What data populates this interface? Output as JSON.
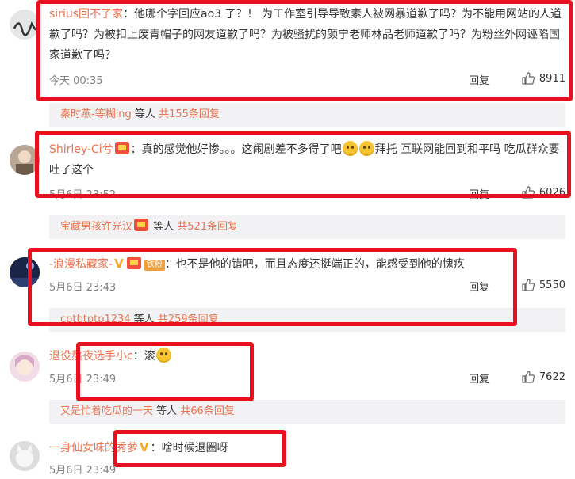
{
  "comments": [
    {
      "username": "sirius回不了家",
      "text": "：他哪个字回应ao3 了？！ 为工作室引导导致素人被网暴道歉了吗？为不能用网站的人道歉了吗？为被扣上废青帽子的网友道歉了吗？为被骚扰的颜宁老师林品老师道歉了吗？为粉丝外网诬陷国家道歉了吗？",
      "time": "今天 00:35",
      "reply": "回复",
      "likes": "8911"
    },
    {
      "username": "Shirley-Ci兮",
      "text_a": "：真的感觉他好惨。。。这闹剧差不多得了吧",
      "text_b": "拜托 互联网能回到和平吗 吃瓜群众要吐了这个",
      "time": "5月6日 23:52",
      "reply": "回复",
      "likes": "6026"
    },
    {
      "username": "-浪漫私藏家-",
      "fan_badge": "铁粉",
      "text": "：也不是他的错吧，而且态度还挺端正的，能感受到他的愧疚",
      "time": "5月6日 23:43",
      "reply": "回复",
      "likes": "5550"
    },
    {
      "username": "退役熬夜选手小c",
      "text": "：滚",
      "time": "5月6日 23:49",
      "reply": "回复",
      "likes": "7622"
    },
    {
      "username": "一身仙女味的秀萝",
      "text": "：啥时候退圈呀",
      "time": "5月6日 23:49",
      "reply": "回复"
    }
  ],
  "subreplies": [
    {
      "username": "秦时燕-等糊ing",
      "mid": " 等人 ",
      "count": "共155条回复"
    },
    {
      "username": "宝藏男孩许光汉",
      "mid": " 等人 ",
      "count": "共521条回复"
    },
    {
      "username": "cptbtptp1234",
      "mid": " 等人 ",
      "count": "共259条回复"
    },
    {
      "username": "又是忙着吃瓜的一天",
      "mid": " 等人 ",
      "count": "共66条回复"
    }
  ],
  "colors": {
    "username": "#eb7350",
    "highlight_box": "#e8101f",
    "subreply_bg": "#f2f2f5"
  }
}
